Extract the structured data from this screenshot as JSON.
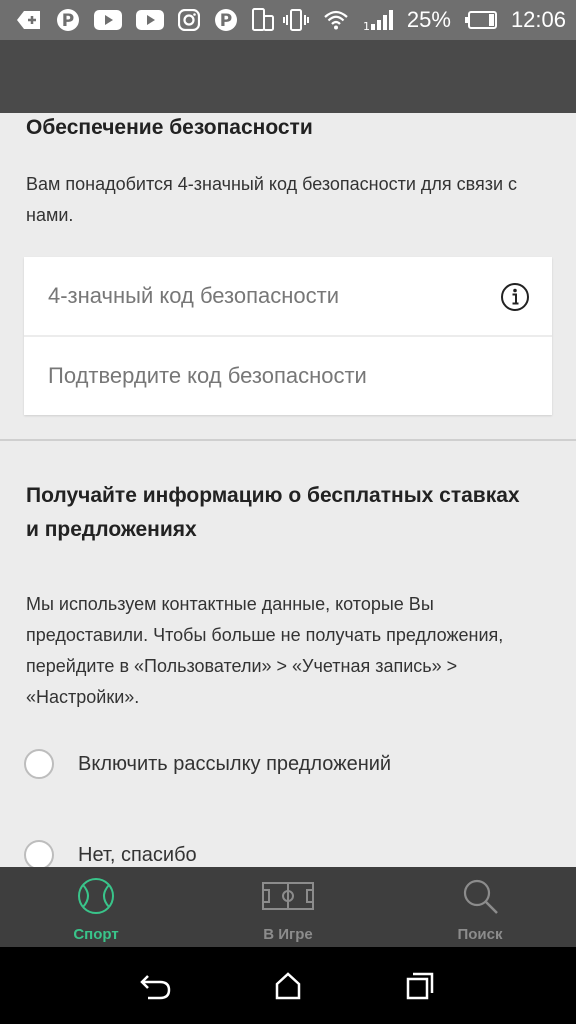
{
  "status_bar": {
    "left_icons": [
      "add-icon",
      "pinterest-icon",
      "youtube-icon",
      "youtube-icon",
      "instagram-icon",
      "pinterest-icon",
      "screen-rotate-icon"
    ],
    "right_icons": [
      "vibrate-icon",
      "wifi-icon",
      "signal-icon",
      "battery-icon"
    ],
    "battery_percent": "25%",
    "time": "12:06"
  },
  "security": {
    "title": "Обеспечение безопасности",
    "description": "Вам понадобится 4-значный код безопасности для связи с нами.",
    "code_placeholder": "4-значный код безопасности",
    "confirm_placeholder": "Подтвердите код безопасности"
  },
  "offers": {
    "title": "Получайте информацию о бесплатных ставках и предложениях",
    "description": "Мы используем контактные данные, которые Вы предоставили. Чтобы больше не получать предложения, перейдите в «Пользователи» > «Учетная запись» > «Настройки».",
    "options": [
      {
        "label": "Включить рассылку предложений"
      },
      {
        "label": "Нет, спасибо"
      }
    ]
  },
  "bottom_nav": {
    "items": [
      {
        "label": "Спорт",
        "icon": "ball-icon",
        "active": true
      },
      {
        "label": "В Игре",
        "icon": "field-icon",
        "active": false
      },
      {
        "label": "Поиск",
        "icon": "search-icon",
        "active": false
      }
    ]
  },
  "colors": {
    "accent": "#39c48a",
    "nav_bg": "#3e3e3e",
    "header_bg": "#4a4a4a",
    "status_bar_bg": "#6f6f6f",
    "page_bg": "#ececec"
  }
}
